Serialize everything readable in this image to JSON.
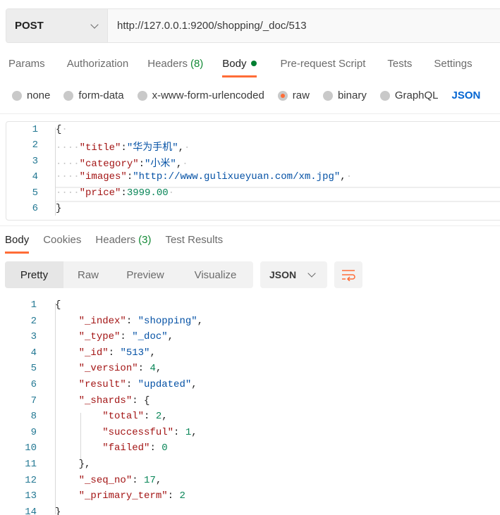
{
  "request": {
    "method": "POST",
    "url": "http://127.0.0.1:9200/shopping/_doc/513"
  },
  "request_tabs": [
    {
      "label": "Params"
    },
    {
      "label": "Authorization"
    },
    {
      "label": "Headers",
      "count": "(8)"
    },
    {
      "label": "Body",
      "active": true,
      "dot": true
    },
    {
      "label": "Pre-request Script"
    },
    {
      "label": "Tests"
    },
    {
      "label": "Settings"
    }
  ],
  "body_types": [
    {
      "label": "none"
    },
    {
      "label": "form-data"
    },
    {
      "label": "x-www-form-urlencoded"
    },
    {
      "label": "raw",
      "selected": true
    },
    {
      "label": "binary"
    },
    {
      "label": "GraphQL"
    }
  ],
  "body_format": "JSON",
  "request_body": [
    [
      [
        "p",
        "{"
      ],
      [
        "ws",
        "·"
      ]
    ],
    [
      [
        "ws",
        "····"
      ],
      [
        "k",
        "\"title\""
      ],
      [
        "p",
        ":"
      ],
      [
        "s",
        "\"华为手机\""
      ],
      [
        "p",
        ","
      ],
      [
        "ws",
        "·"
      ]
    ],
    [
      [
        "ws",
        "····"
      ],
      [
        "k",
        "\"category\""
      ],
      [
        "p",
        ":"
      ],
      [
        "s",
        "\"小米\""
      ],
      [
        "p",
        ","
      ],
      [
        "ws",
        "·"
      ]
    ],
    [
      [
        "ws",
        "····"
      ],
      [
        "k",
        "\"images\""
      ],
      [
        "p",
        ":"
      ],
      [
        "s",
        "\"http://www.gulixueyuan.com/xm.jpg\""
      ],
      [
        "p",
        ","
      ],
      [
        "ws",
        "·"
      ]
    ],
    [
      [
        "ws",
        "····"
      ],
      [
        "k",
        "\"price\""
      ],
      [
        "p",
        ":"
      ],
      [
        "n",
        "3999.00"
      ],
      [
        "ws",
        "·"
      ]
    ],
    [
      [
        "p",
        "}"
      ]
    ]
  ],
  "response_tabs": [
    {
      "label": "Body",
      "active": true
    },
    {
      "label": "Cookies"
    },
    {
      "label": "Headers",
      "count": "(3)"
    },
    {
      "label": "Test Results"
    }
  ],
  "view_modes": [
    {
      "label": "Pretty",
      "active": true
    },
    {
      "label": "Raw"
    },
    {
      "label": "Preview"
    },
    {
      "label": "Visualize"
    }
  ],
  "response_format": "JSON",
  "wrap_icon": "wrap-lines-icon",
  "response_body": [
    [
      [
        "p",
        "{"
      ]
    ],
    [
      [
        "p",
        "    "
      ],
      [
        "k",
        "\"_index\""
      ],
      [
        "p",
        ": "
      ],
      [
        "s",
        "\"shopping\""
      ],
      [
        "p",
        ","
      ]
    ],
    [
      [
        "p",
        "    "
      ],
      [
        "k",
        "\"_type\""
      ],
      [
        "p",
        ": "
      ],
      [
        "s",
        "\"_doc\""
      ],
      [
        "p",
        ","
      ]
    ],
    [
      [
        "p",
        "    "
      ],
      [
        "k",
        "\"_id\""
      ],
      [
        "p",
        ": "
      ],
      [
        "s",
        "\"513\""
      ],
      [
        "p",
        ","
      ]
    ],
    [
      [
        "p",
        "    "
      ],
      [
        "k",
        "\"_version\""
      ],
      [
        "p",
        ": "
      ],
      [
        "n",
        "4"
      ],
      [
        "p",
        ","
      ]
    ],
    [
      [
        "p",
        "    "
      ],
      [
        "k",
        "\"result\""
      ],
      [
        "p",
        ": "
      ],
      [
        "s",
        "\"updated\""
      ],
      [
        "p",
        ","
      ]
    ],
    [
      [
        "p",
        "    "
      ],
      [
        "k",
        "\"_shards\""
      ],
      [
        "p",
        ": {"
      ]
    ],
    [
      [
        "p",
        "        "
      ],
      [
        "k",
        "\"total\""
      ],
      [
        "p",
        ": "
      ],
      [
        "n",
        "2"
      ],
      [
        "p",
        ","
      ]
    ],
    [
      [
        "p",
        "        "
      ],
      [
        "k",
        "\"successful\""
      ],
      [
        "p",
        ": "
      ],
      [
        "n",
        "1"
      ],
      [
        "p",
        ","
      ]
    ],
    [
      [
        "p",
        "        "
      ],
      [
        "k",
        "\"failed\""
      ],
      [
        "p",
        ": "
      ],
      [
        "n",
        "0"
      ]
    ],
    [
      [
        "p",
        "    },"
      ]
    ],
    [
      [
        "p",
        "    "
      ],
      [
        "k",
        "\"_seq_no\""
      ],
      [
        "p",
        ": "
      ],
      [
        "n",
        "17"
      ],
      [
        "p",
        ","
      ]
    ],
    [
      [
        "p",
        "    "
      ],
      [
        "k",
        "\"_primary_term\""
      ],
      [
        "p",
        ": "
      ],
      [
        "n",
        "2"
      ]
    ],
    [
      [
        "p",
        "}"
      ]
    ]
  ],
  "colors": {
    "accent": "#ff6c37",
    "count_green": "#138a36",
    "link_blue": "#0265d2",
    "key": "#a31515",
    "string": "#0451a5",
    "number": "#098658"
  }
}
